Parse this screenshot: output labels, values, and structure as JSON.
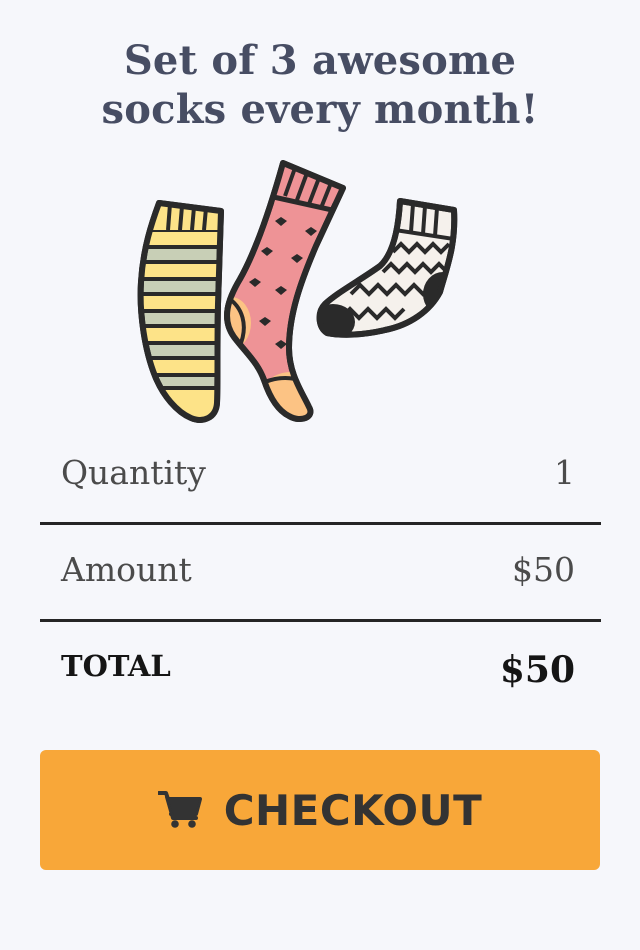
{
  "product": {
    "title_line1": "Set of 3 awesome",
    "title_line2": "socks every month!",
    "image_icon": "socks-illustration"
  },
  "summary": {
    "quantity_label": "Quantity",
    "quantity_value": "1",
    "amount_label": "Amount",
    "amount_value": "$50",
    "total_label": "TOTAL",
    "total_value": "$50"
  },
  "checkout": {
    "label": "CHECKOUT",
    "icon": "cart-icon",
    "color": "#f8a739"
  },
  "colors": {
    "background": "#f6f7fb",
    "title": "#474d63"
  }
}
